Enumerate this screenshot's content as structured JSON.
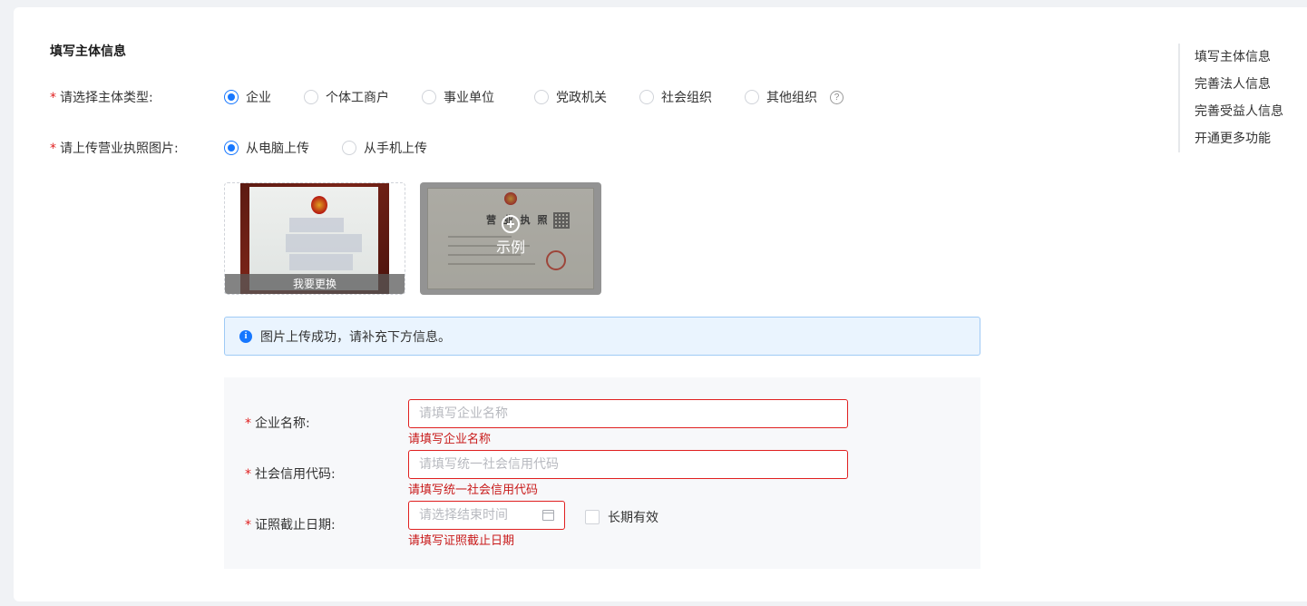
{
  "section_title": "填写主体信息",
  "entity_type": {
    "label": "请选择主体类型:",
    "options": [
      "企业",
      "个体工商户",
      "事业单位",
      "党政机关",
      "社会组织",
      "其他组织"
    ],
    "selected": "企业",
    "help_icon": "question-circle-icon"
  },
  "upload_method": {
    "label": "请上传营业执照图片:",
    "options": [
      "从电脑上传",
      "从手机上传"
    ],
    "selected": "从电脑上传"
  },
  "uploaded_image": {
    "replace_label": "我要更换"
  },
  "example_image": {
    "heading": "营 业 执 照",
    "overlay_label": "示例"
  },
  "alert": {
    "icon": "info-icon",
    "message": "图片上传成功，请补充下方信息。"
  },
  "form": {
    "company_name": {
      "label": "企业名称:",
      "placeholder": "请填写企业名称",
      "value": "",
      "error": "请填写企业名称"
    },
    "credit_code": {
      "label": "社会信用代码:",
      "placeholder": "请填写统一社会信用代码",
      "value": "",
      "error": "请填写统一社会信用代码"
    },
    "expiry_date": {
      "label": "证照截止日期:",
      "placeholder": "请选择结束时间",
      "value": "",
      "error": "请填写证照截止日期",
      "long_term_label": "长期有效",
      "long_term_checked": false
    }
  },
  "anchor_nav": [
    "填写主体信息",
    "完善法人信息",
    "完善受益人信息",
    "开通更多功能"
  ],
  "colors": {
    "primary": "#1677ff",
    "error": "#e02020",
    "alert_bg": "#eaf4fe",
    "alert_border": "#9fcaf5"
  }
}
